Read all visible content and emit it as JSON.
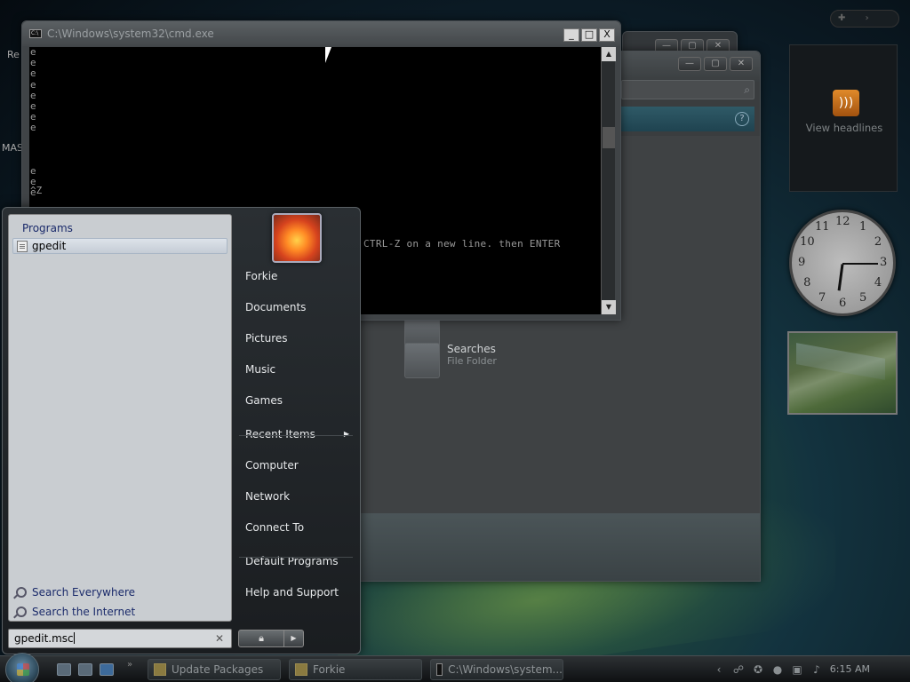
{
  "desktop": {
    "icon_labels": [
      "Re",
      "MAS"
    ]
  },
  "cmd_window": {
    "title": "C:\\Windows\\system32\\cmd.exe",
    "console_lines": [
      "e",
      "e",
      "e",
      "e",
      "e",
      "e",
      "e",
      "e",
      "",
      "",
      "",
      "e",
      "e",
      "e"
    ],
    "ctrlz_line": "^Z",
    "hint_text": "CTRL-Z on a new line. then ENTER",
    "controls": {
      "minimize": "_",
      "maximize": "□",
      "close": "X"
    }
  },
  "explorer_window": {
    "items": [
      {
        "name": "",
        "type": "File Folder"
      },
      {
        "name": "Searches",
        "type": "File Folder"
      }
    ]
  },
  "start_menu": {
    "programs_header": "Programs",
    "programs": [
      {
        "label": "gpedit",
        "icon": "document-icon"
      }
    ],
    "search_links": [
      {
        "label": "Search Everywhere",
        "icon": "magnifier-icon"
      },
      {
        "label": "Search the Internet",
        "icon": "magnifier-icon"
      }
    ],
    "search_value": "gpedit.msc",
    "right_items": [
      {
        "label": "Forkie"
      },
      {
        "label": "Documents"
      },
      {
        "label": "Pictures"
      },
      {
        "label": "Music"
      },
      {
        "label": "Games"
      },
      {
        "label": "Recent Items",
        "has_submenu": true
      },
      {
        "label": "Computer"
      },
      {
        "label": "Network"
      },
      {
        "label": "Connect To"
      },
      {
        "label": "Default Programs"
      },
      {
        "label": "Help and Support"
      }
    ]
  },
  "gadgets": {
    "feed_label": "View headlines",
    "clock": {
      "hour": 6,
      "minute": 15
    },
    "clock_numbers": [
      "12",
      "1",
      "2",
      "3",
      "4",
      "5",
      "6",
      "7",
      "8",
      "9",
      "10",
      "11"
    ]
  },
  "taskbar": {
    "buttons": [
      {
        "label": "Update Packages",
        "icon": "folder-icon"
      },
      {
        "label": "Forkie",
        "icon": "folder-icon"
      },
      {
        "label": "C:\\Windows\\system...",
        "icon": "cmd-icon"
      }
    ],
    "time": "6:15 AM"
  }
}
